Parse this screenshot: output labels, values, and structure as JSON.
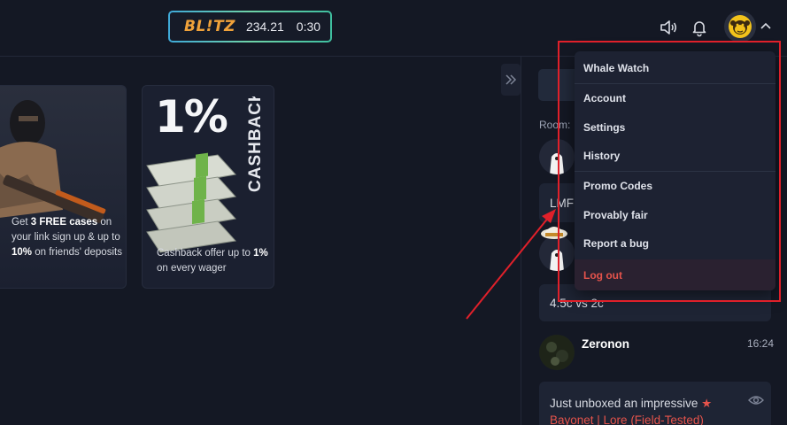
{
  "topbar": {
    "blitz_logo": "BL!TZ",
    "blitz_value": "234.21",
    "blitz_time": "0:30",
    "icons": [
      "volume-icon",
      "bell-icon",
      "user-avatar",
      "chevron-up-icon"
    ]
  },
  "banners": [
    {
      "pre": "Get ",
      "strong1": "3 FREE cases",
      "mid": " on your link sign up & up to ",
      "strong2": "10%",
      "post": " on friends' deposits"
    },
    {
      "headline": "1%",
      "side_label": "CASHBACK",
      "pre": "Cashback offer up to ",
      "strong": "1%",
      "post": " on every wager"
    }
  ],
  "chat": {
    "room_label": "Room:",
    "partial_msg_1": "LMF",
    "partial_msg_2": "4.5c vs 2c",
    "message": {
      "username": "Zeronon",
      "time": "16:24",
      "text": "Just unboxed an impressive",
      "star": "★",
      "item": "Bayonet | Lore (Field-Tested)"
    }
  },
  "dropdown": {
    "username": "Whale Watch",
    "items": [
      "Account",
      "Settings",
      "History",
      "Promo Codes",
      "Provably fair",
      "Report a bug"
    ],
    "logout": "Log out"
  },
  "colors": {
    "background": "#141824",
    "accent_orange": "#f0a23a",
    "danger_red": "#e5534b",
    "highlight_red": "#e0202a"
  }
}
